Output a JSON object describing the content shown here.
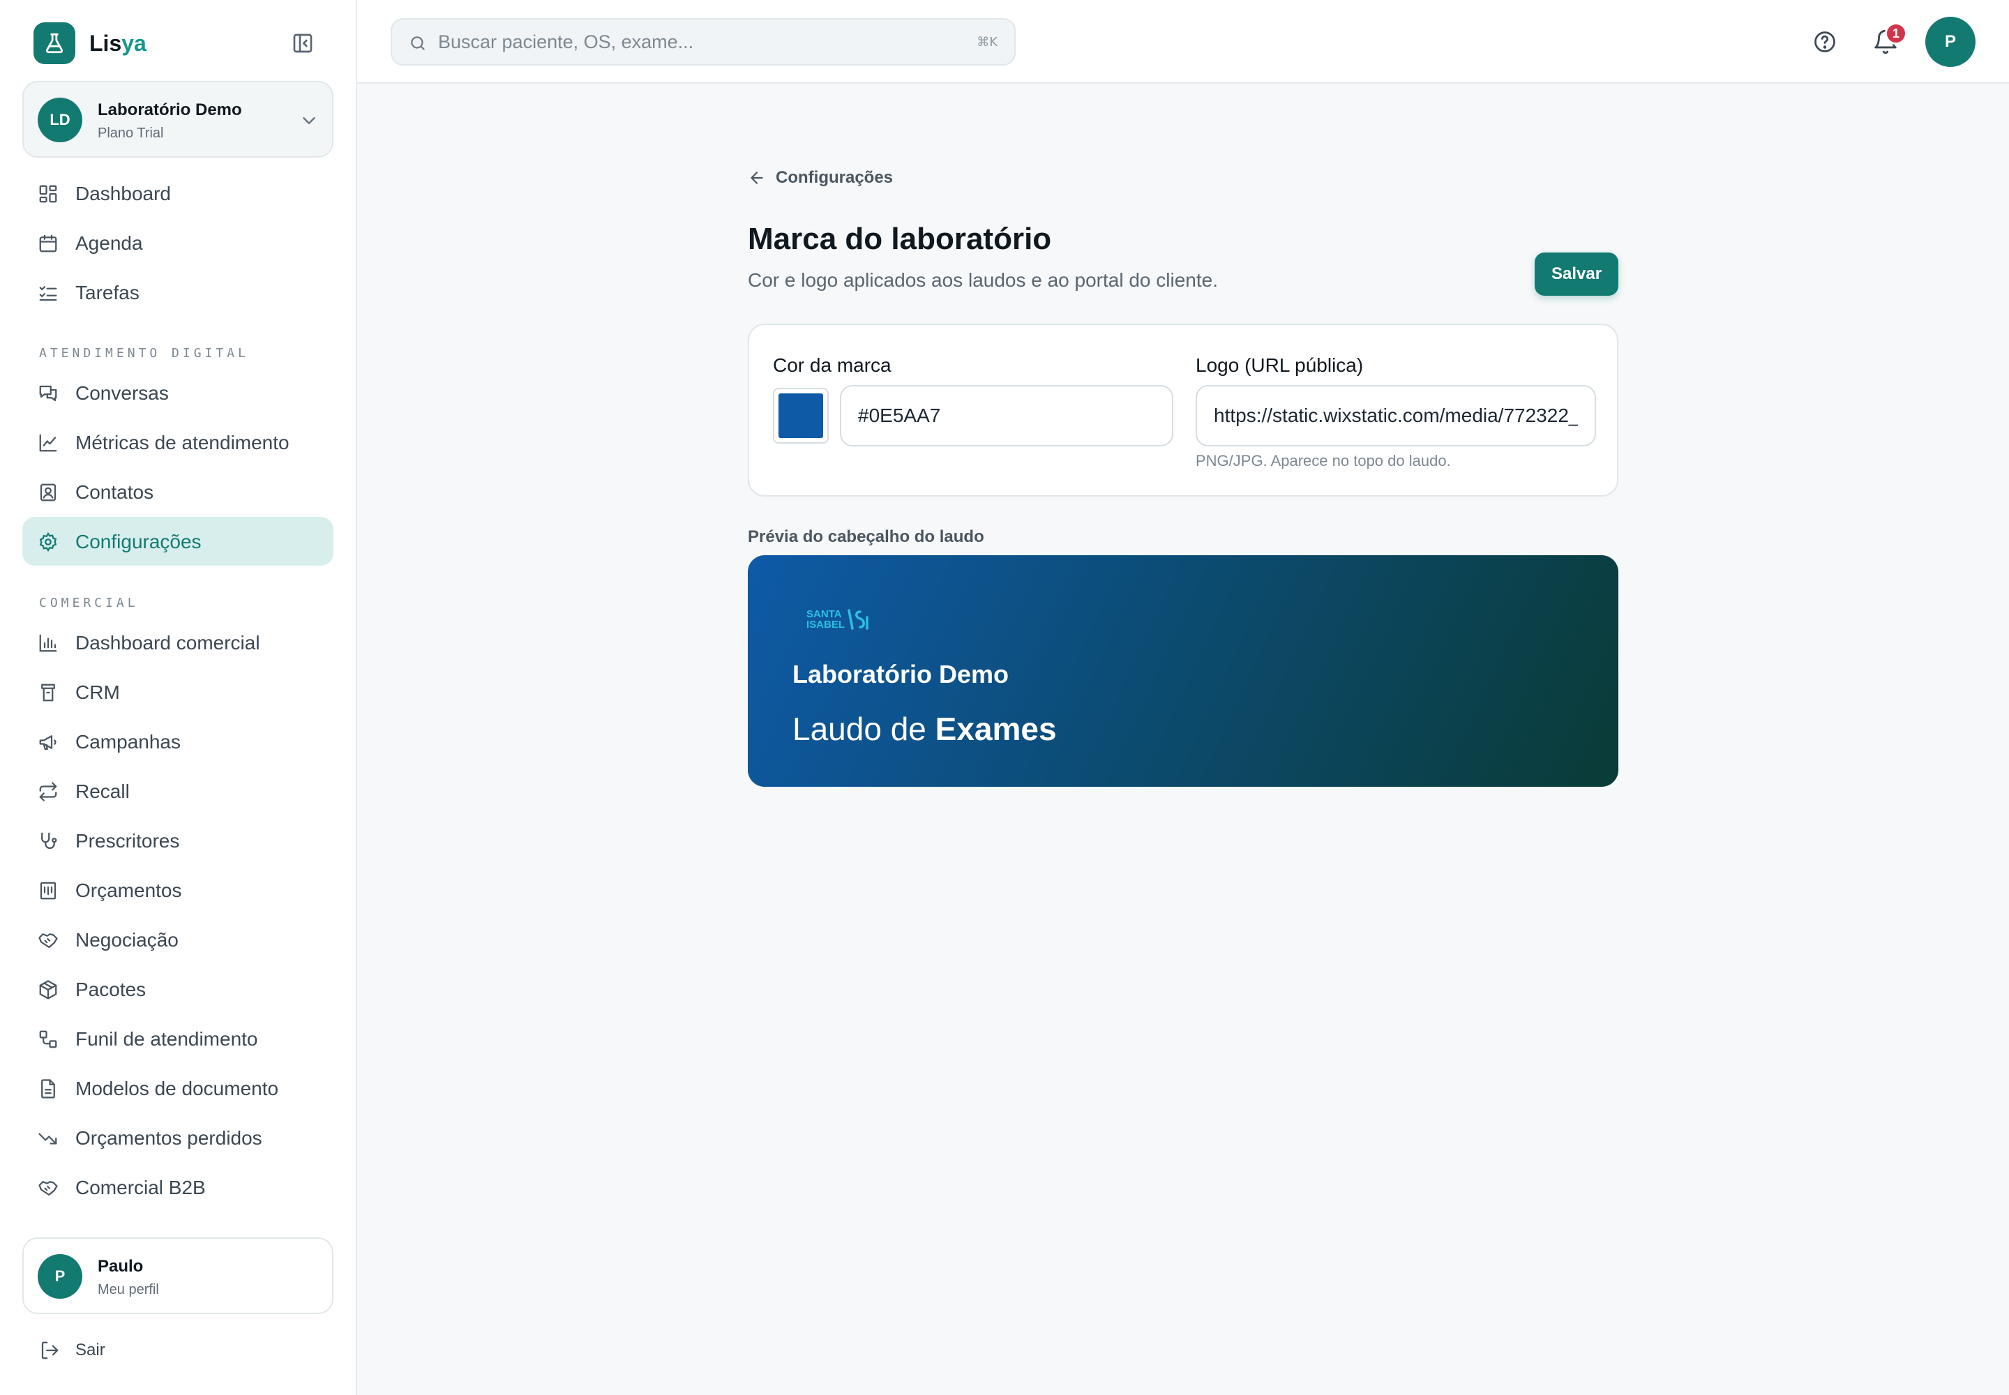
{
  "app": {
    "name_main": "Lis",
    "name_accent": "ya"
  },
  "org": {
    "initials": "LD",
    "name": "Laboratório Demo",
    "plan": "Plano Trial"
  },
  "nav_main": [
    {
      "label": "Dashboard",
      "icon": "dashboard-icon"
    },
    {
      "label": "Agenda",
      "icon": "calendar-icon"
    },
    {
      "label": "Tarefas",
      "icon": "checklist-icon"
    }
  ],
  "sections": {
    "digital": "ATENDIMENTO DIGITAL",
    "commercial": "COMERCIAL"
  },
  "nav_digital": [
    {
      "label": "Conversas",
      "icon": "chat-icon"
    },
    {
      "label": "Métricas de atendimento",
      "icon": "line-chart-icon"
    },
    {
      "label": "Contatos",
      "icon": "contact-icon"
    },
    {
      "label": "Configurações",
      "icon": "gear-icon",
      "active": true
    }
  ],
  "nav_commercial": [
    {
      "label": "Dashboard comercial",
      "icon": "bar-chart-icon"
    },
    {
      "label": "CRM",
      "icon": "crm-icon"
    },
    {
      "label": "Campanhas",
      "icon": "megaphone-icon"
    },
    {
      "label": "Recall",
      "icon": "repeat-icon"
    },
    {
      "label": "Prescritores",
      "icon": "stethoscope-icon"
    },
    {
      "label": "Orçamentos",
      "icon": "receipt-icon"
    },
    {
      "label": "Negociação",
      "icon": "handshake-icon"
    },
    {
      "label": "Pacotes",
      "icon": "package-icon"
    },
    {
      "label": "Funil de atendimento",
      "icon": "workflow-icon"
    },
    {
      "label": "Modelos de documento",
      "icon": "document-icon"
    },
    {
      "label": "Orçamentos perdidos",
      "icon": "trending-down-icon"
    },
    {
      "label": "Comercial B2B",
      "icon": "handshake-icon"
    }
  ],
  "user": {
    "initial": "P",
    "name": "Paulo",
    "subtitle": "Meu perfil"
  },
  "logout_label": "Sair",
  "search": {
    "placeholder": "Buscar paciente, OS, exame...",
    "shortcut": "⌘K"
  },
  "notifications": {
    "count": "1"
  },
  "top_avatar": "P",
  "page": {
    "back_label": "Configurações",
    "title": "Marca do laboratório",
    "subtitle": "Cor e logo aplicados aos laudos e ao portal do cliente.",
    "save_label": "Salvar"
  },
  "form": {
    "color_label": "Cor da marca",
    "color_value": "#0E5AA7",
    "logo_label": "Logo (URL pública)",
    "logo_value": "https://static.wixstatic.com/media/772322_",
    "logo_hint": "PNG/JPG. Aparece no topo do laudo."
  },
  "preview": {
    "label": "Prévia do cabeçalho do laudo",
    "logo_line1": "SANTA",
    "logo_line2": "ISABEL",
    "org_name": "Laboratório Demo",
    "doc_prefix": "Laudo de",
    "doc_strong": "Exames",
    "gradient_start": "#0E5AA7",
    "gradient_end": "#0A3B36"
  },
  "colors": {
    "accent": "#137A72",
    "badge": "#D2354A"
  }
}
